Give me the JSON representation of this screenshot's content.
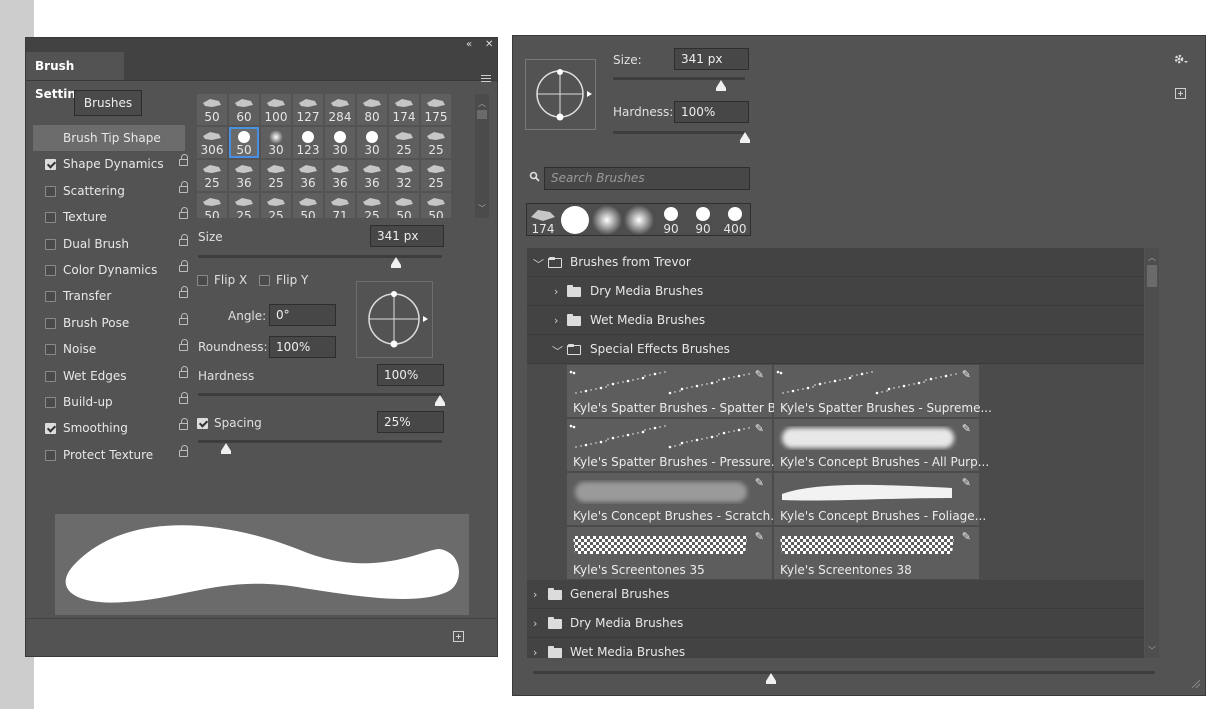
{
  "brush_settings": {
    "tab_title": "Brush Settings",
    "collapse_glyph": "«",
    "close_glyph": "✕",
    "brushes_button": "Brushes",
    "brush_tip_shape": "Brush Tip Shape",
    "options": [
      {
        "label": "Shape Dynamics",
        "checked": true
      },
      {
        "label": "Scattering",
        "checked": false
      },
      {
        "label": "Texture",
        "checked": false
      },
      {
        "label": "Dual Brush",
        "checked": false
      },
      {
        "label": "Color Dynamics",
        "checked": false
      },
      {
        "label": "Transfer",
        "checked": false
      },
      {
        "label": "Brush Pose",
        "checked": false
      },
      {
        "label": "Noise",
        "checked": false
      },
      {
        "label": "Wet Edges",
        "checked": false
      },
      {
        "label": "Build-up",
        "checked": false
      },
      {
        "label": "Smoothing",
        "checked": true
      },
      {
        "label": "Protect Texture",
        "checked": false
      }
    ],
    "tip_sizes": [
      "50",
      "60",
      "100",
      "127",
      "284",
      "80",
      "174",
      "175",
      "306",
      "50",
      "30",
      "123",
      "30",
      "30",
      "25",
      "25",
      "25",
      "36",
      "25",
      "36",
      "36",
      "36",
      "32",
      "25",
      "50",
      "25",
      "25",
      "50",
      "71",
      "25",
      "50",
      "50"
    ],
    "size_label": "Size",
    "size_value": "341 px",
    "flip_x": "Flip X",
    "flip_y": "Flip Y",
    "angle_label": "Angle:",
    "angle_value": "0°",
    "roundness_label": "Roundness:",
    "roundness_value": "100%",
    "hardness_label": "Hardness",
    "hardness_value": "100%",
    "spacing_label": "Spacing",
    "spacing_value": "25%",
    "spacing_checked": true
  },
  "brushes_panel": {
    "size_label": "Size:",
    "size_value": "341 px",
    "hardness_label": "Hardness:",
    "hardness_value": "100%",
    "search_placeholder": "Search Brushes",
    "recent_sizes": [
      "174",
      "",
      "",
      "",
      "90",
      "90",
      "400"
    ],
    "groups": {
      "trevor": "Brushes from Trevor",
      "dry": "Dry Media Brushes",
      "wet": "Wet Media Brushes",
      "special": "Special Effects Brushes",
      "general": "General Brushes",
      "dry2": "Dry Media Brushes",
      "wet2": "Wet Media Brushes"
    },
    "brush_names": [
      "Kyle's Spatter Brushes - Spatter B...",
      "Kyle's Spatter Brushes - Supreme...",
      "Kyle's Spatter Brushes - Pressure...",
      "Kyle's Concept Brushes - All Purp...",
      "Kyle's Concept Brushes - Scratch...",
      "Kyle's Concept Brushes - Foliage...",
      "Kyle's Screentones 35",
      "Kyle's Screentones 38"
    ]
  },
  "colors": {
    "panel_bg": "#535353",
    "selection_blue": "#4a90e2"
  },
  "icons": [
    "lock-icon",
    "gear-icon",
    "new-brush-icon",
    "search-icon",
    "folder-icon",
    "chevron-right-icon",
    "chevron-down-icon",
    "paintbrush-icon",
    "resize-grip-icon"
  ]
}
